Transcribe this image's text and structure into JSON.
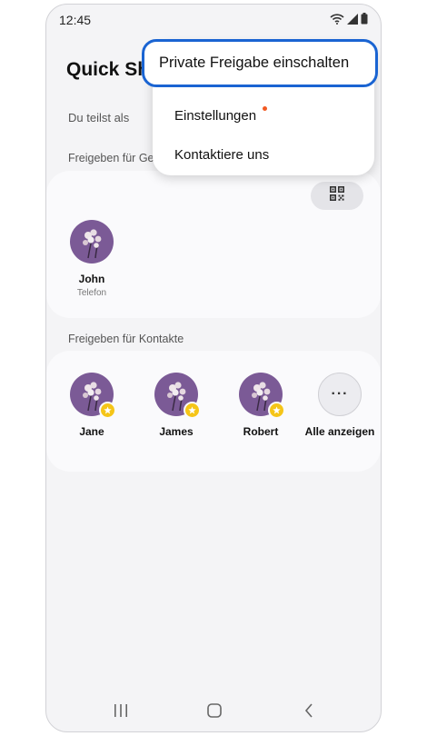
{
  "status_bar": {
    "time": "12:45",
    "icons": [
      "wifi-icon",
      "signal-icon",
      "battery-icon"
    ]
  },
  "header": {
    "title": "Quick Sh"
  },
  "sharing_as": {
    "label": "Du teilst als"
  },
  "nearby": {
    "label": "Freigeben für Ge",
    "qr_icon": "qr-code-icon",
    "devices": [
      {
        "name": "John",
        "subtitle": "Telefon"
      }
    ]
  },
  "contacts": {
    "label": "Freigeben für Kontakte",
    "items": [
      {
        "name": "Jane",
        "favorite": true
      },
      {
        "name": "James",
        "favorite": true
      },
      {
        "name": "Robert",
        "favorite": true
      }
    ],
    "show_all_label": "Alle anzeigen"
  },
  "menu": {
    "items": [
      {
        "label": "Private Freigabe einschalten",
        "highlighted": true
      },
      {
        "label": "Einstellungen",
        "badge": true
      },
      {
        "label": "Kontaktiere uns"
      }
    ]
  },
  "nav_bar": {
    "icons": [
      "recents-icon",
      "home-icon",
      "back-icon"
    ]
  },
  "colors": {
    "highlight_border": "#1a64d2",
    "avatar_bg": "#7b5a96",
    "badge": "#f25a22",
    "favorite_star": "#f5c518"
  }
}
